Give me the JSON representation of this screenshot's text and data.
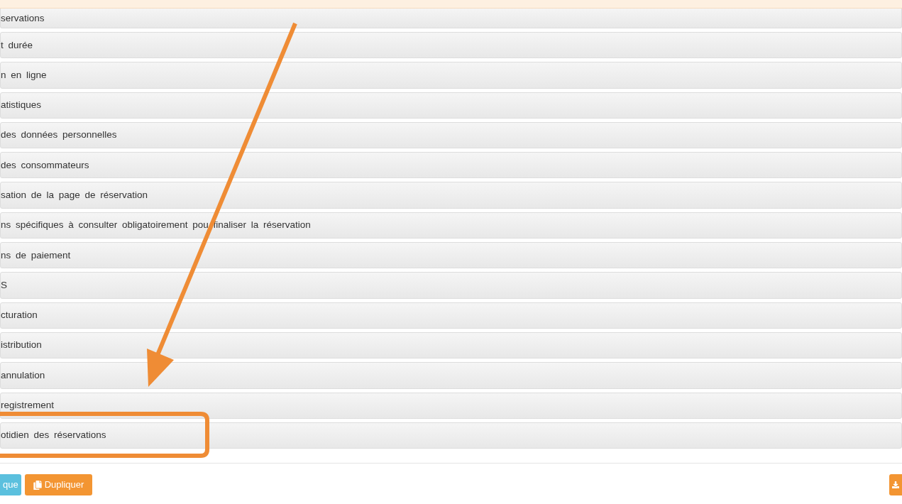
{
  "sections": [
    {
      "label": "servations"
    },
    {
      "label": "t durée"
    },
    {
      "label": "n en ligne"
    },
    {
      "label": "atistiques"
    },
    {
      "label": "des données personnelles"
    },
    {
      "label": "des consommateurs"
    },
    {
      "label": "sation de la page de réservation"
    },
    {
      "label": "ns spécifiques à consulter obligatoirement pou finaliser la réservation"
    },
    {
      "label": "ns de paiement"
    },
    {
      "label": "S"
    },
    {
      "label": "cturation"
    },
    {
      "label": "istribution"
    },
    {
      "label": "annulation"
    },
    {
      "label": "registrement"
    },
    {
      "label": "otidien des réservations"
    }
  ],
  "buttons": [
    {
      "kind": "info",
      "label": "que"
    },
    {
      "kind": "duplicate",
      "label": "Dupliquer"
    },
    {
      "kind": "download"
    }
  ]
}
